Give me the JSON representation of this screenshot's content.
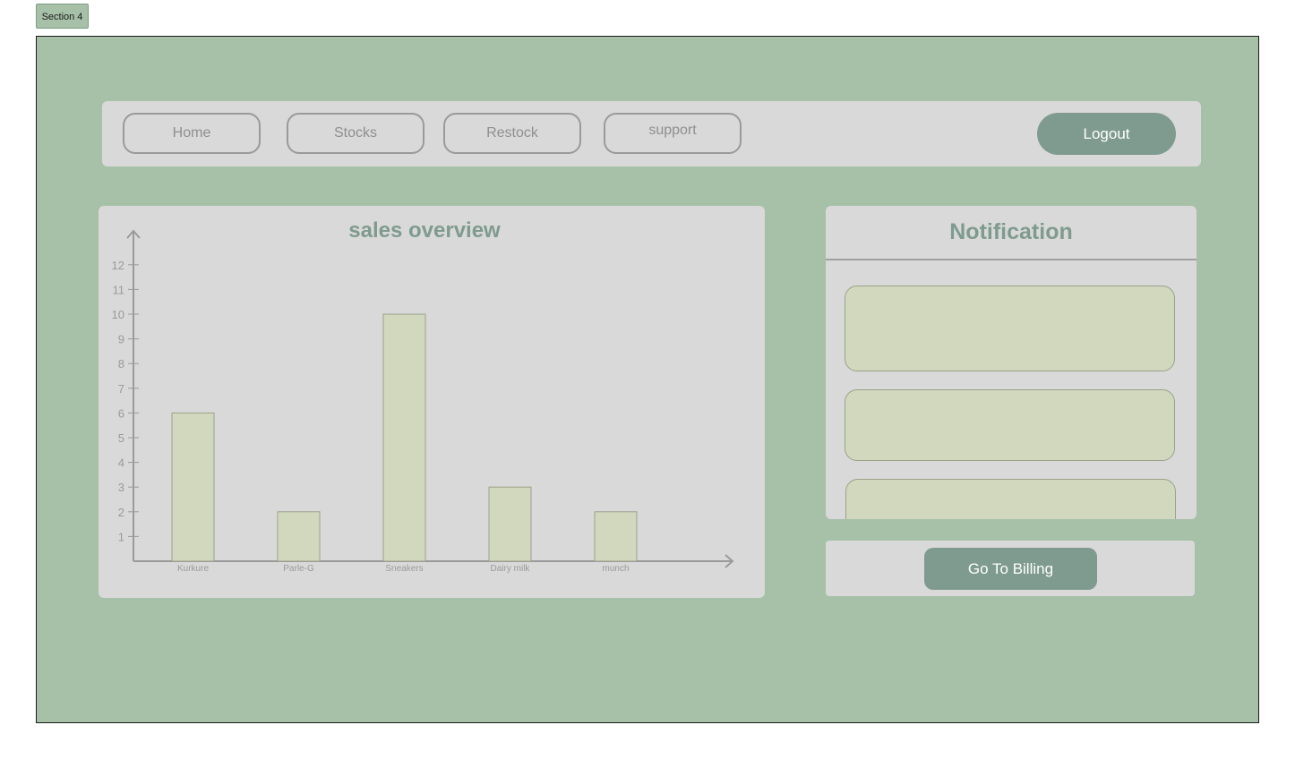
{
  "section_label": "Section 4",
  "nav": {
    "home": "Home",
    "stocks": "Stocks",
    "restock": "Restock",
    "support": "support",
    "logout": "Logout"
  },
  "colors": {
    "background": "#a7c1a8",
    "panel": "#d9d9d9",
    "accent": "#7f9b8f",
    "bar_fill": "#d1d8bd"
  },
  "notification": {
    "title": "Notification"
  },
  "billing": {
    "button_label": "Go To Billing"
  },
  "chart_data": {
    "type": "bar",
    "title": "sales overview",
    "categories": [
      "Kurkure",
      "Parle-G",
      "Sneakers",
      "Dairy milk",
      "munch"
    ],
    "values": [
      6,
      2,
      10,
      3,
      2
    ],
    "yticks": [
      1,
      2,
      3,
      4,
      5,
      6,
      7,
      8,
      9,
      10,
      11,
      12
    ],
    "ylim": [
      0,
      13
    ],
    "xlabel": "",
    "ylabel": "",
    "grid": false
  }
}
